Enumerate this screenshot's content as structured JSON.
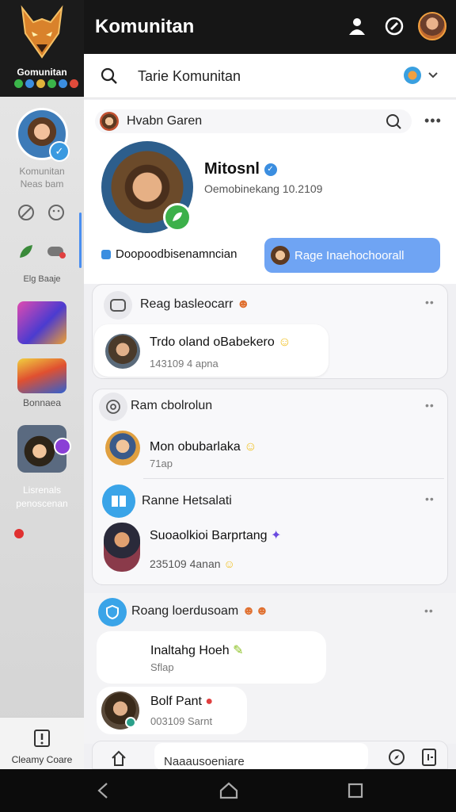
{
  "app": {
    "logo_label": "Gomunitan",
    "title": "Komunitan"
  },
  "sidebar": {
    "profile_label_1": "Komunitan",
    "profile_label_2": "Neas bam",
    "icons_label": "Elg  Baaje",
    "tile_label": "Bonnaea",
    "game_label_1": "Lisrenals",
    "game_label_2": "penoscenan",
    "bottom_label": "Cleamy Coare"
  },
  "search": {
    "text": "Tarie Komunitan"
  },
  "header": {
    "row_title": "Hvabn Garen",
    "name": "Mitosnl",
    "subtitle": "Oemobinekang 10.2109",
    "left_pill": "Doopoodbisenamncian",
    "right_pill": "Rage Inaehochoorall"
  },
  "groups": [
    {
      "title": "Reag basleocarr",
      "messages": [
        {
          "title": "Trdo oland oBabekero",
          "sub": "143109 4 apna"
        }
      ]
    },
    {
      "title": "Ram cbolrolun",
      "messages": [
        {
          "title": "Mon obubarlaka",
          "sub": "71ap"
        }
      ]
    },
    {
      "title": "Ranne Hetsalati",
      "messages": [
        {
          "title": "Suoaolkioi Barprtang",
          "sub": "235109 4anan"
        }
      ]
    },
    {
      "title": "Roang loerdusoam",
      "messages": [
        {
          "title": "Inaltahg Hoeh",
          "sub": "Sflap"
        },
        {
          "title": "Bolf  Pant",
          "sub": "003109 Sarnt"
        }
      ]
    }
  ],
  "composer": {
    "placeholder": "Naaausoeniare"
  },
  "colors": {
    "accent": "#6fa4f3",
    "topbar": "#161616",
    "online": "#3cb04a"
  }
}
